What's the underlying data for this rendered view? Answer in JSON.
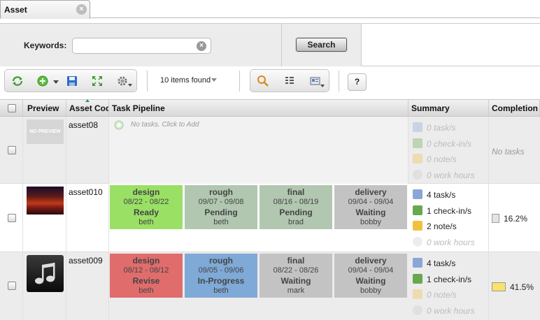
{
  "tab": {
    "title": "Asset",
    "close_symbol": "×"
  },
  "search": {
    "keywords_label": "Keywords:",
    "keywords_value": "",
    "clear_symbol": "×",
    "button_label": "Search"
  },
  "toolbar": {
    "items_found": "10 items found",
    "help_label": "?"
  },
  "columns": [
    "Preview",
    "Asset Cod",
    "Task Pipeline",
    "Summary",
    "Completion"
  ],
  "rows": [
    {
      "code": "asset08",
      "preview_text": "NO PREVIEW",
      "no_tasks_text": "No tasks. Click to Add",
      "summary": [
        "0 task/s",
        "0 check-in/s",
        "0 note/s",
        "0 work hours"
      ],
      "completion_text": "No tasks"
    },
    {
      "code": "asset010",
      "tasks": [
        {
          "name": "design",
          "dates": "08/22 - 08/22",
          "status": "Ready",
          "user": "beth",
          "color": "#99e065"
        },
        {
          "name": "rough",
          "dates": "09/07 - 09/08",
          "status": "Pending",
          "user": "beth",
          "color": "#b1c7b0"
        },
        {
          "name": "final",
          "dates": "08/16 - 08/19",
          "status": "Pending",
          "user": "brad",
          "color": "#b1c7b0"
        },
        {
          "name": "delivery",
          "dates": "09/04 - 09/04",
          "status": "Waiting",
          "user": "bobby",
          "color": "#c3c3c3"
        }
      ],
      "summary": [
        "4 task/s",
        "1 check-in/s",
        "2 note/s",
        "0 work hours"
      ],
      "completion": "16.2%",
      "completion_color": "#e4e4e4"
    },
    {
      "code": "asset009",
      "tasks": [
        {
          "name": "design",
          "dates": "08/12 - 08/12",
          "status": "Revise",
          "user": "beth",
          "color": "#e06c6c"
        },
        {
          "name": "rough",
          "dates": "09/05 - 09/06",
          "status": "In-Progress",
          "user": "beth",
          "color": "#7fa9d6"
        },
        {
          "name": "final",
          "dates": "08/22 - 08/26",
          "status": "Waiting",
          "user": "mark",
          "color": "#c3c3c3"
        },
        {
          "name": "delivery",
          "dates": "09/04 - 09/04",
          "status": "Waiting",
          "user": "bobby",
          "color": "#c3c3c3"
        }
      ],
      "summary": [
        "4 task/s",
        "1 check-in/s",
        "0 note/s",
        "0 work hours"
      ],
      "completion": "41.5%",
      "completion_color": "#f7e36a"
    }
  ]
}
